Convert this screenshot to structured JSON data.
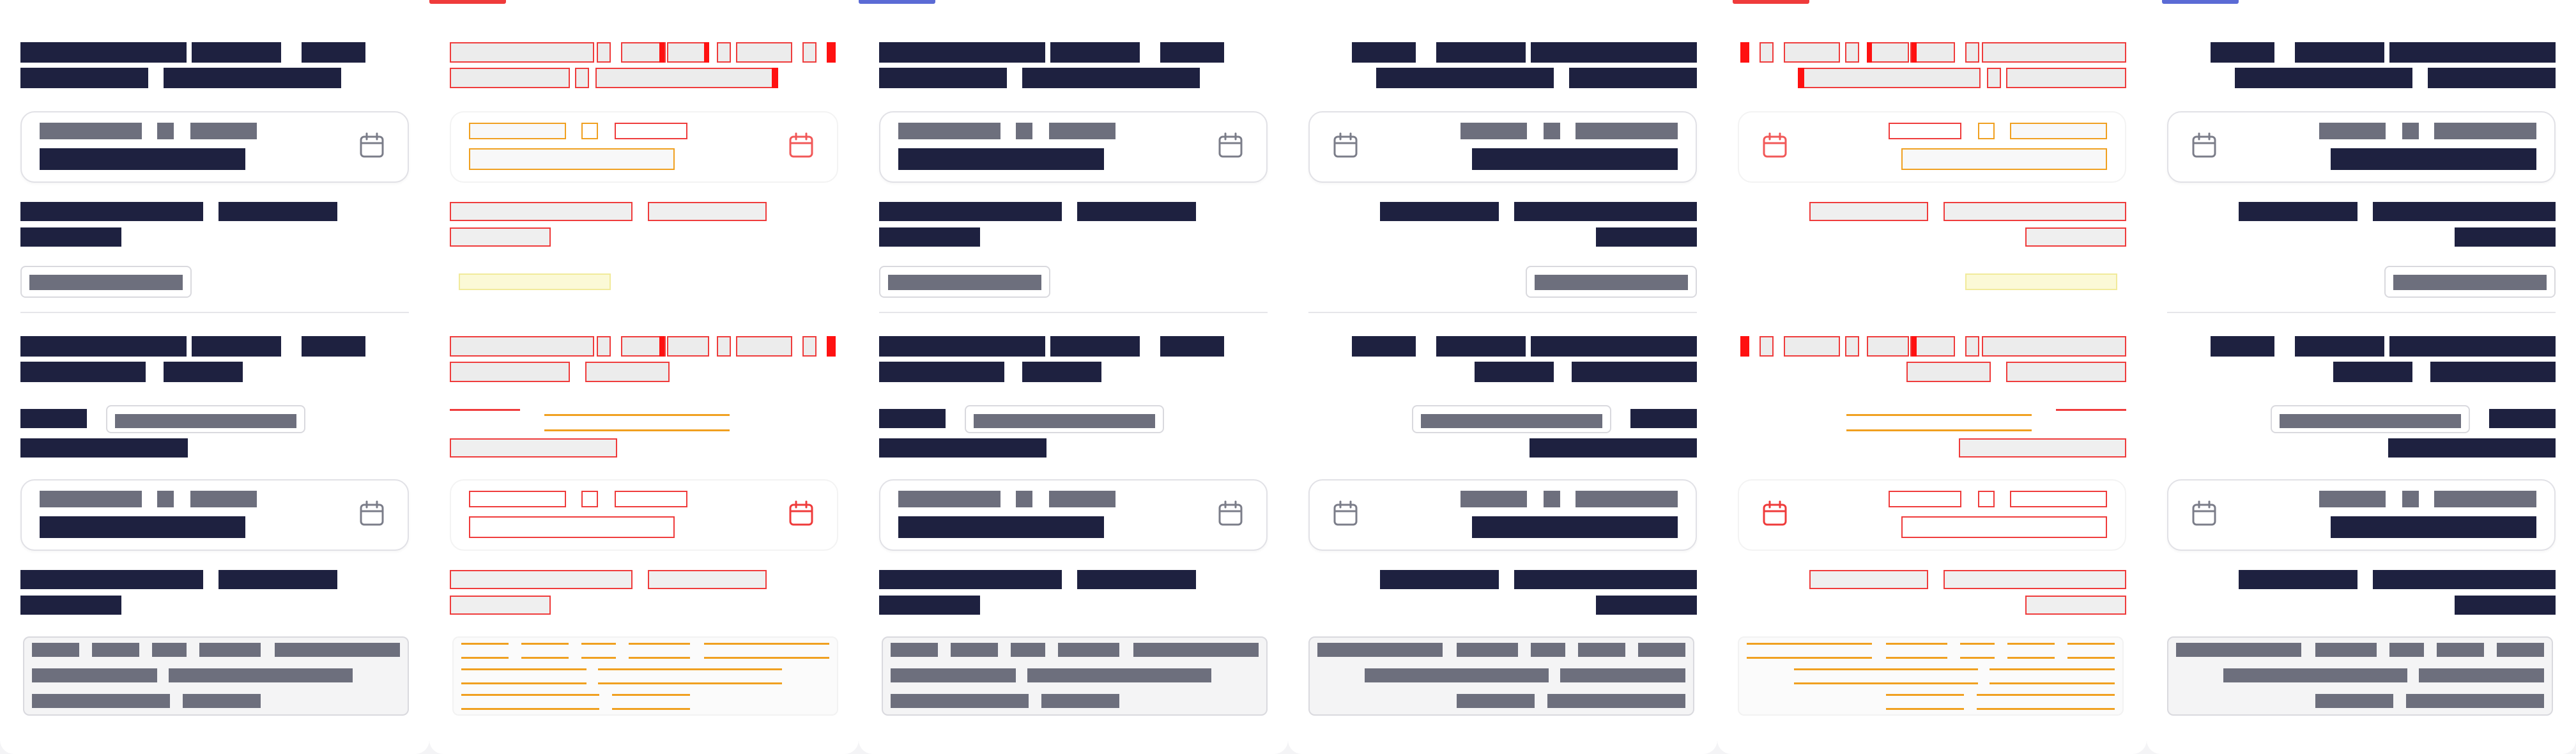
{
  "screen": {
    "panels": [
      {
        "id": "ltr-default",
        "direction": "ltr",
        "variant": "default",
        "accent_color": "#ffffff"
      },
      {
        "id": "ltr-overlay",
        "direction": "ltr",
        "variant": "overlay",
        "accent_color": "#ef3b3b"
      },
      {
        "id": "ltr-focused",
        "direction": "ltr",
        "variant": "default",
        "accent_color": "#5b6bd5"
      },
      {
        "id": "rtl-default",
        "direction": "rtl",
        "variant": "default",
        "accent_color": "#ffffff"
      },
      {
        "id": "rtl-overlay",
        "direction": "rtl",
        "variant": "overlay",
        "accent_color": "#ef3b3b"
      },
      {
        "id": "rtl-focused",
        "direction": "rtl",
        "variant": "default",
        "accent_color": "#5b6bd5"
      }
    ],
    "colors": {
      "text_dark": "#1e2140",
      "text_muted": "#6d6f7d",
      "border": "#e1e1e6",
      "overlay_red": "#ef3b3b",
      "overlay_orange": "#f0a020",
      "overlay_yellow": "#f1ea9b",
      "accent_blue": "#5b6bd5"
    },
    "icons": {
      "date_field": "calendar-icon"
    }
  }
}
